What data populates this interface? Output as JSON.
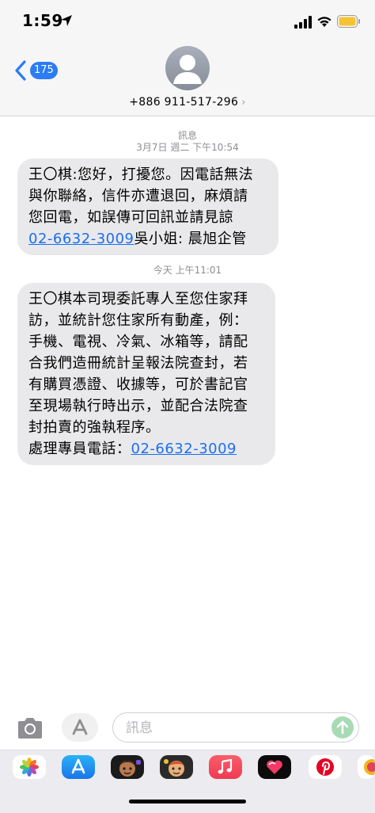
{
  "status_bar": {
    "time": "1:59"
  },
  "header": {
    "back_badge": "175",
    "contact": "+886 911-517-296",
    "chevron": "›"
  },
  "thread": {
    "service_label": "訊息",
    "timestamp_1": "3月7日 週二 下午10:54",
    "message_1": {
      "lines": [
        "王〇棋:您好，打擾您。因電話無法",
        "與你聯絡，信件亦遭退回，麻煩請",
        "您回電，如誤傳可回訊並請見諒"
      ],
      "phone": "02-6632-3009",
      "suffix": "吳小姐: 晨旭企管"
    },
    "timestamp_2": "今天 上午11:01",
    "message_2": {
      "lines": [
        "王〇棋本司現委託專人至您住家拜",
        "訪，並統計您住家所有動產，例：",
        "手機、電視、冷氣、冰箱等，請配",
        "合我們造冊統計呈報法院查封，若",
        "有購買憑證、收據等，可於書記官",
        "至現場執行時出示，並配合法院查",
        "封拍賣的強執程序。"
      ],
      "prefix": "處理專員電話：",
      "phone": "02-6632-3009"
    }
  },
  "input": {
    "placeholder": "訊息",
    "value": ""
  },
  "colors": {
    "bubble": "#e9e9eb",
    "link": "#1b6ff0",
    "badge": "#2b7cf5",
    "send": "#a7dbb3"
  },
  "tray_apps": [
    "photos-icon",
    "app-store-icon",
    "memoji-icon",
    "memoji-2-icon",
    "music-icon",
    "digital-touch-icon",
    "pinterest-icon",
    "more-icon"
  ]
}
